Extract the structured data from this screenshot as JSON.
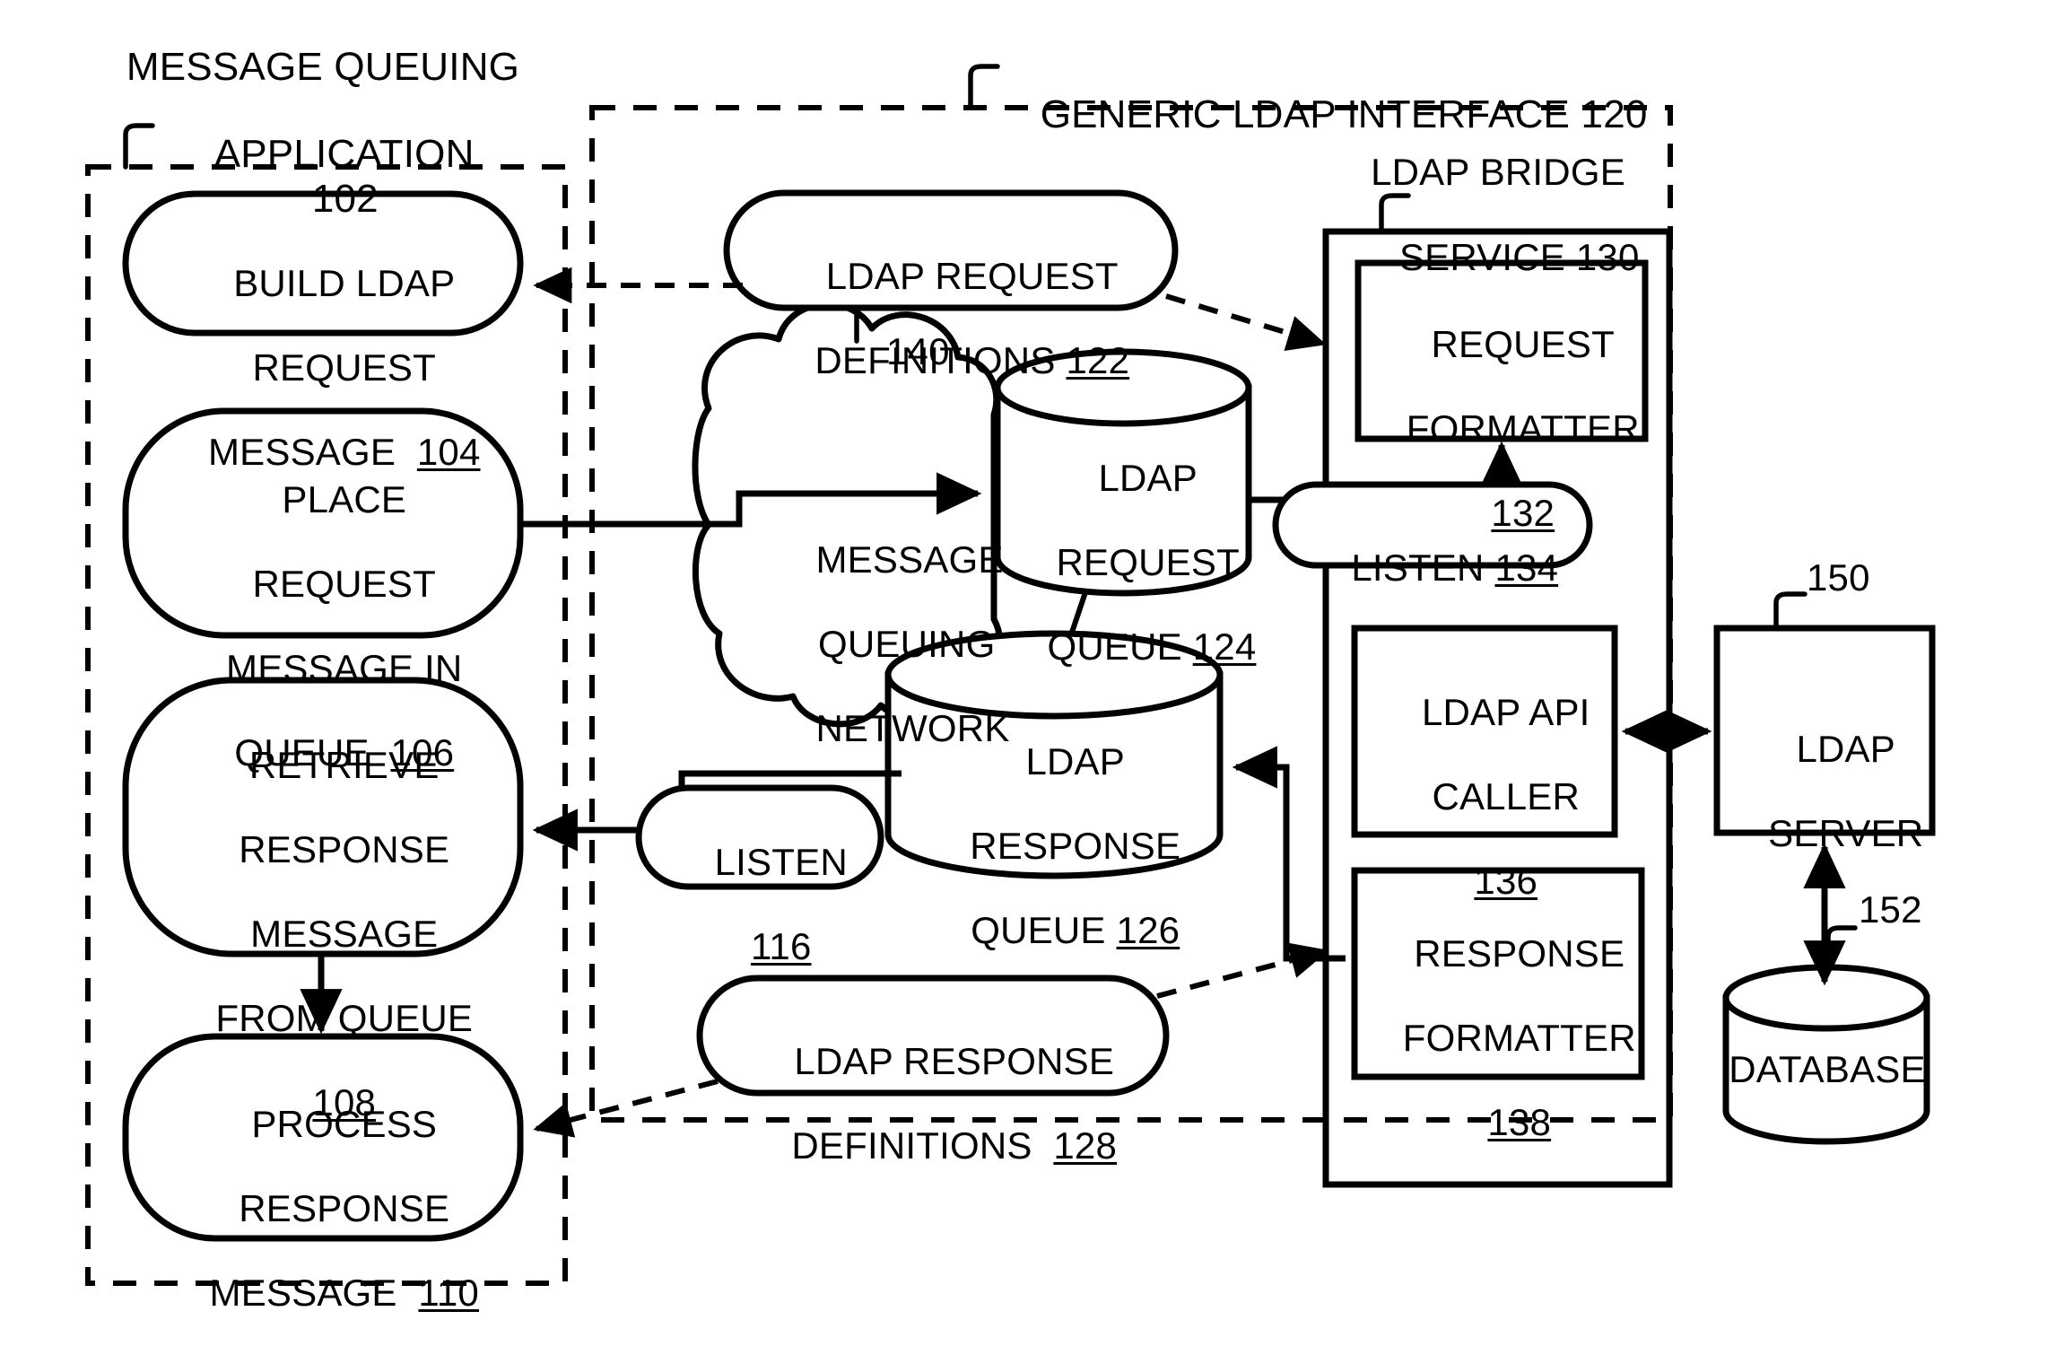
{
  "figure": {
    "title_left": "MESSAGE QUEUING APPLICATION 102",
    "title_right": "GENERIC LDAP INTERFACE 120"
  },
  "mq_application": {
    "caption_line1": "MESSAGE QUEUING",
    "caption_line2": "APPLICATION",
    "caption_ref": "102",
    "steps": [
      {
        "id": "build-ldap-request-message",
        "lines": [
          "BUILD LDAP",
          "REQUEST",
          "MESSAGE"
        ],
        "ref": "104",
        "ref_inline": true
      },
      {
        "id": "place-request-message-in-queue",
        "lines": [
          "PLACE",
          "REQUEST",
          "MESSAGE IN",
          "QUEUE"
        ],
        "ref": "106",
        "ref_inline": true
      },
      {
        "id": "retrieve-response-message-from-queue",
        "lines": [
          "RETRIEVE",
          "RESPONSE",
          "MESSAGE",
          "FROM QUEUE"
        ],
        "ref": "108",
        "ref_inline": false
      },
      {
        "id": "process-response-message",
        "lines": [
          "PROCESS",
          "RESPONSE",
          "MESSAGE"
        ],
        "ref": "110",
        "ref_inline": true
      }
    ],
    "listen": {
      "label": "LISTEN",
      "ref": "116"
    }
  },
  "generic_ldap_interface": {
    "caption": "GENERIC LDAP INTERFACE",
    "caption_ref": "120",
    "request_definitions": {
      "line1": "LDAP REQUEST",
      "line2": "DEFINITIONS",
      "ref": "122"
    },
    "response_definitions": {
      "line1": "LDAP RESPONSE",
      "line2": "DEFINITIONS",
      "ref": "128"
    },
    "network_cloud": {
      "lines": [
        "MESSAGE",
        "QUEUING",
        "NETWORK"
      ],
      "ref": "140"
    },
    "request_queue": {
      "line1": "LDAP",
      "line2": "REQUEST",
      "line3": "QUEUE",
      "ref": "124"
    },
    "response_queue": {
      "line1": "LDAP",
      "line2": "RESPONSE",
      "line3": "QUEUE",
      "ref": "126"
    },
    "bridge_service": {
      "caption_line1": "LDAP BRIDGE",
      "caption_line2": "SERVICE",
      "caption_ref": "130",
      "listen": {
        "label": "LISTEN",
        "ref": "134"
      },
      "components": [
        {
          "id": "request-formatter",
          "line1": "REQUEST",
          "line2": "FORMATTER",
          "ref": "132"
        },
        {
          "id": "ldap-api-caller",
          "line1": "LDAP API",
          "line2": "CALLER",
          "ref": "136"
        },
        {
          "id": "response-formatter",
          "line1": "RESPONSE",
          "line2": "FORMATTER",
          "ref": "138"
        }
      ]
    }
  },
  "external": {
    "ldap_server": {
      "line1": "LDAP",
      "line2": "SERVER",
      "ref": "150"
    },
    "database": {
      "label": "DATABASE",
      "ref": "152"
    }
  },
  "colors": {
    "stroke": "#000000",
    "background": "#ffffff"
  }
}
